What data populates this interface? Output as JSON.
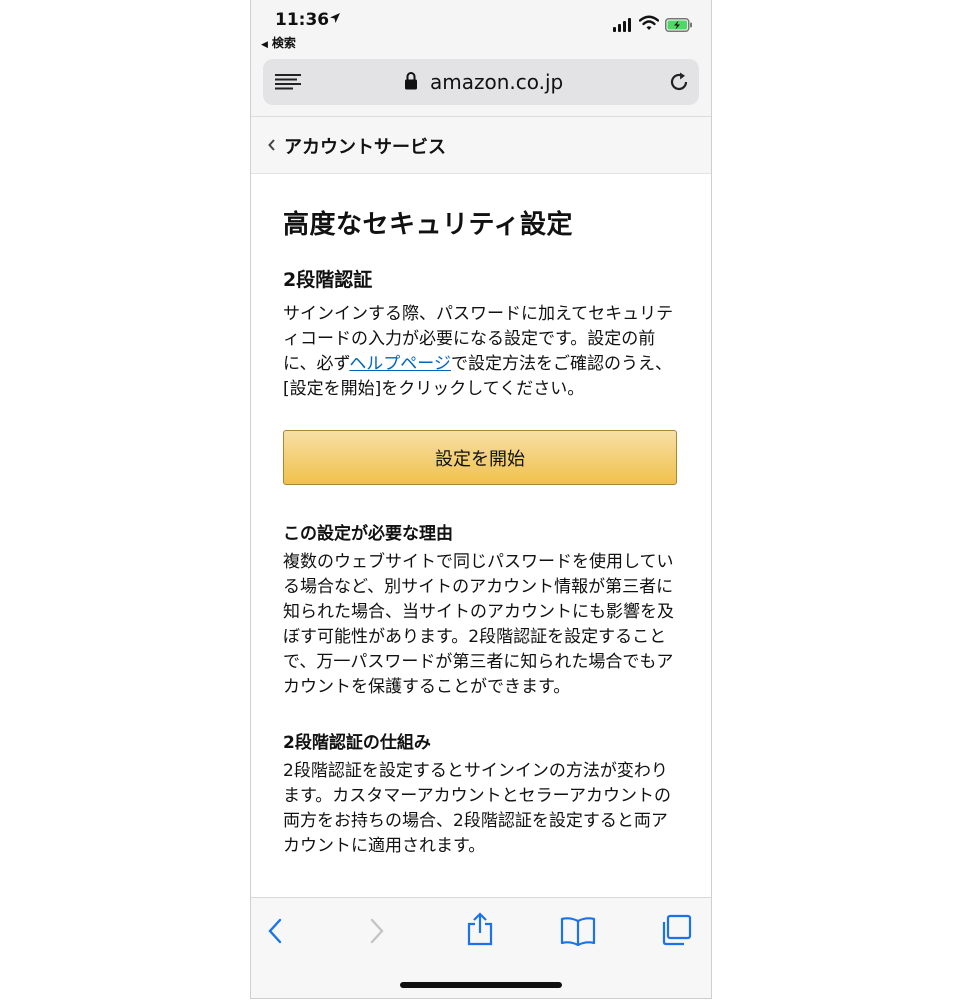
{
  "status_bar": {
    "time": "11:36",
    "back_app_label": "検索"
  },
  "browser": {
    "url": "amazon.co.jp"
  },
  "breadcrumb": {
    "label": "アカウントサービス"
  },
  "page": {
    "title": "高度なセキュリティ設定",
    "section_title": "2段階認証",
    "intro_before_link": "サインインする際、パスワードに加えてセキュリティコードの入力が必要になる設定です。設定の前に、必ず",
    "help_link": "ヘルプページ",
    "intro_after_link": "で設定方法をご確認のうえ、[設定を開始]をクリックしてください。",
    "start_button": "設定を開始",
    "reason_title": "この設定が必要な理由",
    "reason_text": "複数のウェブサイトで同じパスワードを使用している場合など、別サイトのアカウント情報が第三者に知られた場合、当サイトのアカウントにも影響を及ぼす可能性があります。2段階認証を設定することで、万一パスワードが第三者に知られた場合でもアカウントを保護することができます。",
    "mechanism_title": "2段階認証の仕組み",
    "mechanism_text": "2段階認証を設定するとサインインの方法が変わります。カスタマーアカウントとセラーアカウントの両方をお持ちの場合、2段階認証を設定すると両アカウントに適用されます。"
  },
  "colors": {
    "link": "#0066c0",
    "toolbar_icon": "#1a73e8",
    "button_top": "#f7dfa5",
    "button_bottom": "#f0c14b",
    "battery_fill": "#4cd964"
  },
  "icons": {
    "status": [
      "location-arrow-icon",
      "signal-icon",
      "wifi-icon",
      "battery-charging-icon"
    ],
    "browser": [
      "menu-icon",
      "lock-icon",
      "reload-icon"
    ],
    "toolbar": [
      "back-icon",
      "forward-icon",
      "share-icon",
      "bookmarks-icon",
      "tabs-icon"
    ]
  }
}
